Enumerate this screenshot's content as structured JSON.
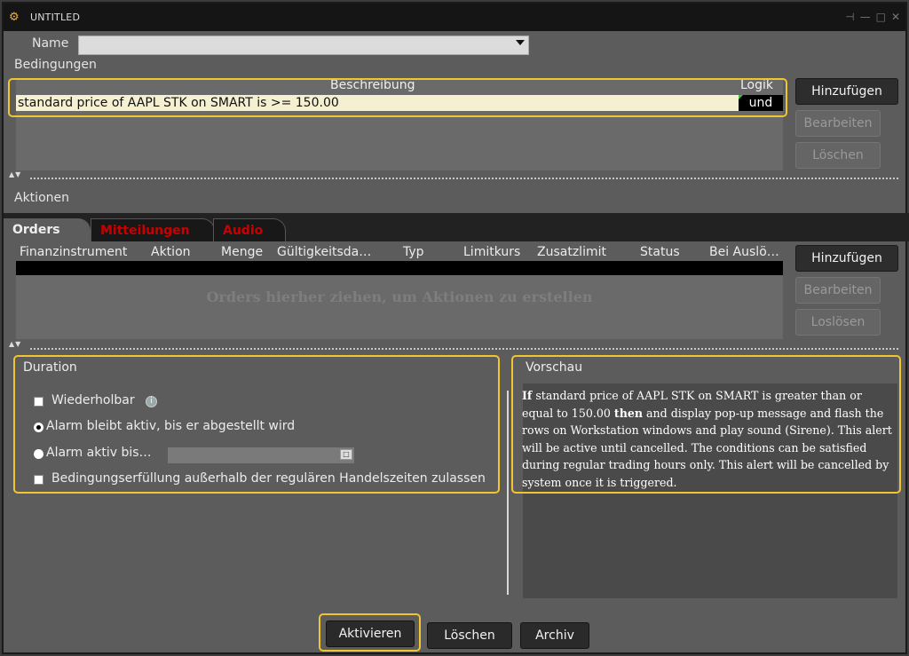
{
  "window": {
    "title": "UNTITLED"
  },
  "name_label": "Name",
  "conditions": {
    "section_label": "Bedingungen",
    "col_description": "Beschreibung",
    "col_logic": "Logik",
    "rows": [
      {
        "description": "standard price of AAPL STK on SMART is >= 150.00",
        "logic": "und"
      }
    ],
    "buttons": {
      "add": "Hinzufügen",
      "edit": "Bearbeiten",
      "delete": "Löschen"
    }
  },
  "actions": {
    "section_label": "Aktionen",
    "tabs": [
      "Orders",
      "Mitteilungen",
      "Audio"
    ],
    "columns": [
      "Finanzinstrument",
      "Aktion",
      "Menge",
      "Gültigkeitsda…",
      "Typ",
      "Limitkurs",
      "Zusatzlimit",
      "Status",
      "Bei Auslö…"
    ],
    "empty_hint": "Orders hierher ziehen, um Aktionen zu erstellen",
    "buttons": {
      "add": "Hinzufügen",
      "edit": "Bearbeiten",
      "detach": "Loslösen"
    }
  },
  "duration": {
    "title": "Duration",
    "repeatable": "Wiederholbar",
    "alarm_until_off": "Alarm bleibt aktiv, bis er abgestellt wird",
    "alarm_until": "Alarm aktiv bis…",
    "outside_hours": "Bedingungserfüllung außerhalb der regulären Handelszeiten zulassen"
  },
  "preview": {
    "title": "Vorschau",
    "if_word": "If",
    "part1": " standard price of AAPL STK on SMART is greater than or equal to 150.00 ",
    "then_word": "then",
    "part2": " and display pop-up message and flash the rows on Workstation windows and play sound (Sirene). This alert will be active until cancelled. The conditions can be satisfied during regular trading hours only. This alert will be cancelled by system once it is triggered."
  },
  "footer": {
    "activate": "Aktivieren",
    "delete": "Löschen",
    "archive": "Archiv"
  },
  "colors": {
    "highlight": "#f2c430",
    "tab_red": "#c80000"
  }
}
